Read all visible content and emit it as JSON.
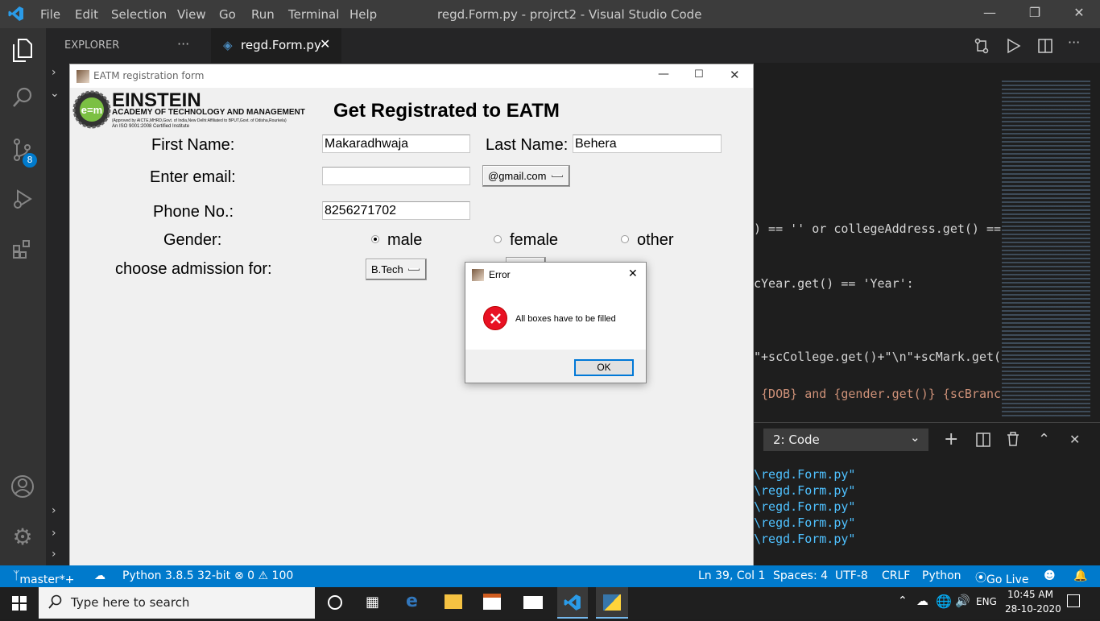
{
  "vscode": {
    "menu": [
      "File",
      "Edit",
      "Selection",
      "View",
      "Go",
      "Run",
      "Terminal",
      "Help"
    ],
    "window_title": "regd.Form.py - projrct2 - Visual Studio Code",
    "explorer_label": "EXPLORER",
    "explorer_more": "···",
    "tab_label": "regd.Form.py",
    "source_control_badge": "8",
    "code_lines": [
      ") == '' or collegeAddress.get() ==",
      "cYear.get() == 'Year':",
      "\"+scCollege.get()+\"\\n\"+scMark.get(",
      " {DOB} and {gender.get()} {scBranc"
    ],
    "panel_select": "2: Code",
    "terminal_lines": [
      "\\regd.Form.py\"",
      "\\regd.Form.py\"",
      "\\regd.Form.py\"",
      "\\regd.Form.py\"",
      "\\regd.Form.py\""
    ]
  },
  "statusbar": {
    "branch": "master*+",
    "python": "Python 3.8.5 32-bit",
    "problems": "⊗ 0 ⚠ 100",
    "position": "Ln 39, Col 1",
    "spaces": "Spaces: 4",
    "encoding": "UTF-8",
    "eol": "CRLF",
    "language": "Python",
    "golive": "Go Live"
  },
  "taskbar": {
    "search_placeholder": "Type here to search",
    "lang": "ENG",
    "time": "10:45 AM",
    "date": "28-10-2020"
  },
  "form": {
    "window_title": "EATM registration form",
    "logo_name": "EINSTEIN",
    "logo_sub": "ACADEMY OF TECHNOLOGY AND MANAGEMENT",
    "logo_line3": "(Approved by AICTE,MHRD,Govt. of India,New Delhi:Affiliated to BPUT,Govt. of Odisha,Rourkela)",
    "logo_line4": "An ISO 9001:2008 Certified Institute",
    "heading": "Get Registrated to EATM",
    "first_name_label": "First Name:",
    "first_name_value": "Makaradhwaja",
    "last_name_label": "Last Name:",
    "last_name_value": "Behera",
    "email_label": "Enter email:",
    "email_value": "",
    "email_domain": "@gmail.com",
    "phone_label": "Phone No.:",
    "phone_value": "8256271702",
    "gender_label": "Gender:",
    "gender_options": [
      "male",
      "female",
      "other"
    ],
    "gender_selected": "male",
    "admission_label": "choose admission for:",
    "admission_value": "B.Tech"
  },
  "dialog": {
    "title": "Error",
    "message": "All boxes have to be filled",
    "ok_label": "OK",
    "close": "✕"
  },
  "colors": {
    "accent": "#007acc",
    "error_icon": "#e81123"
  }
}
